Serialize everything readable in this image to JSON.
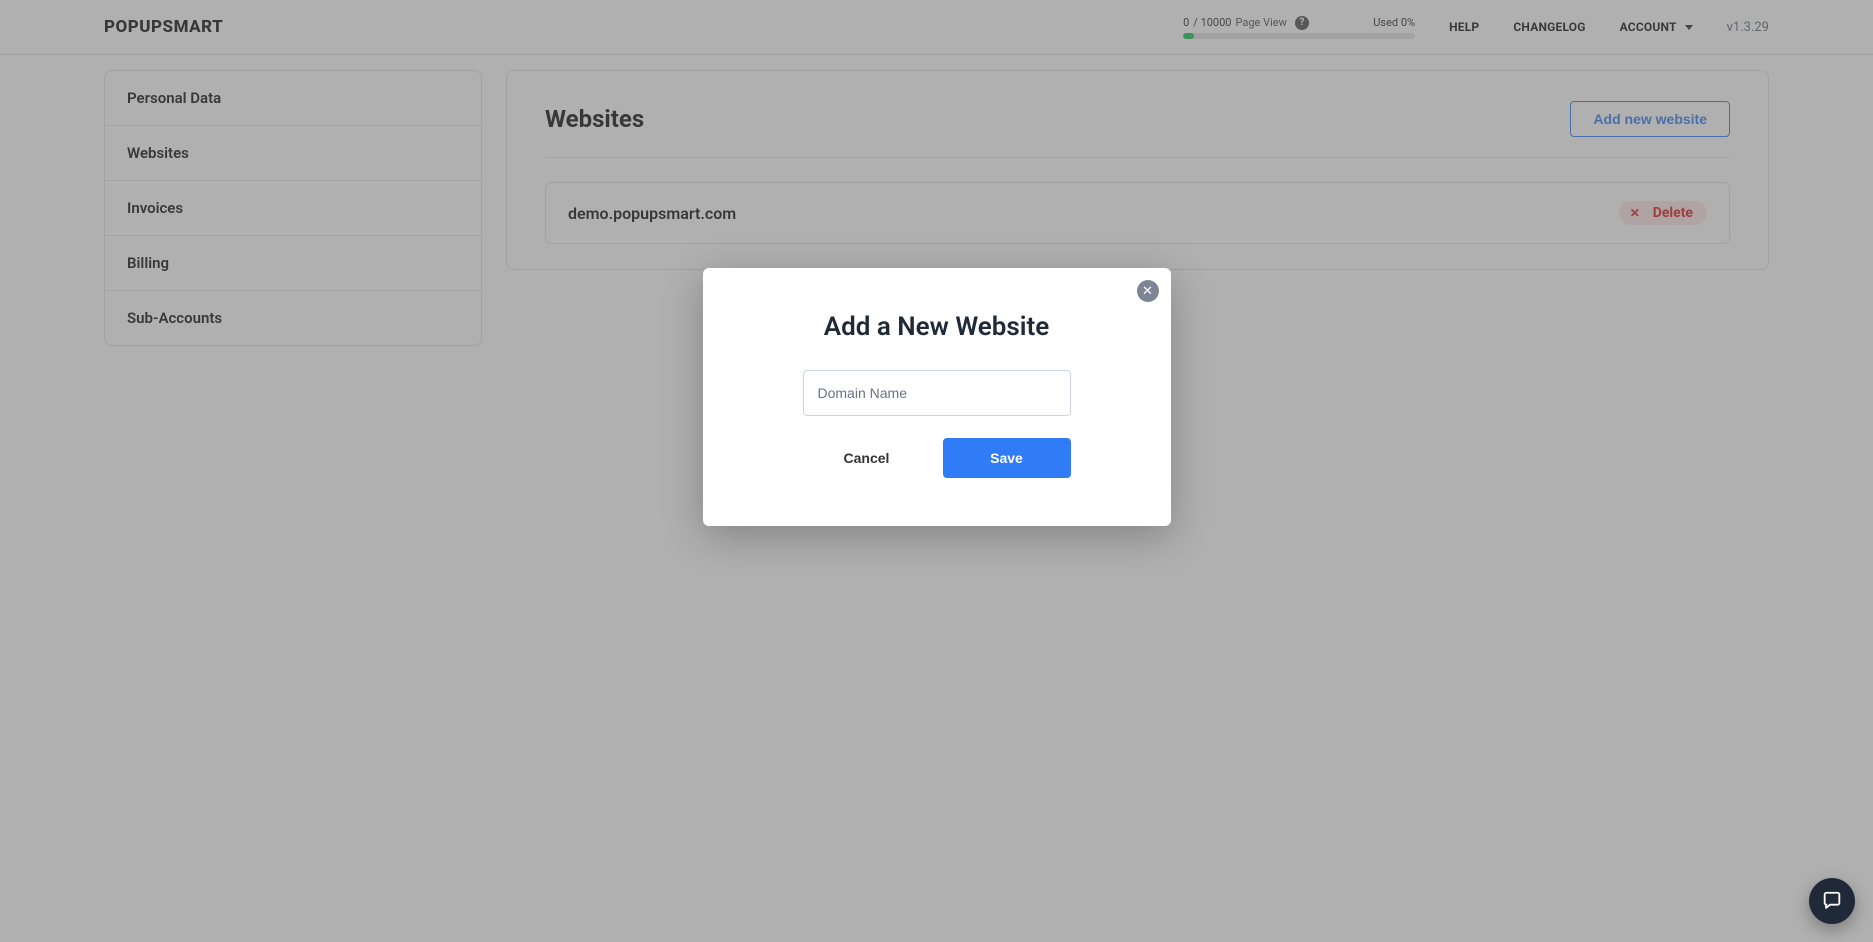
{
  "header": {
    "brand": "POPUPSMART",
    "usage": {
      "count": "0",
      "slash_max": "/ 10000",
      "label": "Page View",
      "used_label": "Used 0%"
    },
    "nav": {
      "help": "HELP",
      "changelog": "CHANGELOG",
      "account": "ACCOUNT"
    },
    "version": "v1.3.29"
  },
  "sidebar": {
    "items": [
      {
        "label": "Personal Data"
      },
      {
        "label": "Websites"
      },
      {
        "label": "Invoices"
      },
      {
        "label": "Billing"
      },
      {
        "label": "Sub-Accounts"
      }
    ]
  },
  "main": {
    "title": "Websites",
    "add_button": "Add new website",
    "sites": [
      {
        "domain": "demo.popupsmart.com",
        "delete_label": "Delete"
      }
    ]
  },
  "modal": {
    "title": "Add a New Website",
    "domain_placeholder": "Domain Name",
    "cancel": "Cancel",
    "save": "Save"
  }
}
